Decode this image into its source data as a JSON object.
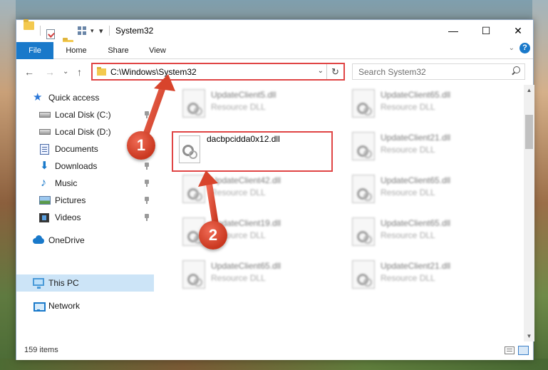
{
  "window": {
    "title": "System32",
    "minimize_glyph": "—",
    "maximize_glyph": "☐",
    "close_glyph": "✕"
  },
  "ribbon": {
    "tabs": [
      "File",
      "Home",
      "Share",
      "View"
    ],
    "help_glyph": "?",
    "expand_glyph": "⌄"
  },
  "address_bar": {
    "path": "C:\\Windows\\System32",
    "back_glyph": "←",
    "forward_glyph": "→",
    "recent_glyph": "⌄",
    "up_glyph": "↑",
    "dropdown_glyph": "⌄",
    "refresh_glyph": "↻"
  },
  "search": {
    "placeholder": "Search System32"
  },
  "nav_pane": {
    "items": [
      {
        "label": "Quick access",
        "icon": "star-icon",
        "pinned": false
      },
      {
        "label": "Local Disk (C:)",
        "icon": "drive-icon",
        "pinned": true
      },
      {
        "label": "Local Disk (D:)",
        "icon": "drive-icon",
        "pinned": false
      },
      {
        "label": "Documents",
        "icon": "documents-icon",
        "pinned": true
      },
      {
        "label": "Downloads",
        "icon": "download-icon",
        "pinned": true
      },
      {
        "label": "Music",
        "icon": "music-icon",
        "pinned": true
      },
      {
        "label": "Pictures",
        "icon": "pictures-icon",
        "pinned": true
      },
      {
        "label": "Videos",
        "icon": "videos-icon",
        "pinned": true
      },
      {
        "label": "OneDrive",
        "icon": "cloud-icon",
        "pinned": false
      },
      {
        "label": "This PC",
        "icon": "computer-icon",
        "pinned": false,
        "selected": true
      },
      {
        "label": "Network",
        "icon": "network-icon",
        "pinned": false
      }
    ]
  },
  "files": {
    "left_column": [
      {
        "name": "UpdateClient5.dll",
        "type": "Resource DLL"
      },
      {
        "name": "dacbpcidda0x12.dll",
        "type": ""
      },
      {
        "name": "UpdateClient42.dll",
        "type": "Resource DLL"
      },
      {
        "name": "UpdateClient19.dll",
        "type": "Resource DLL"
      },
      {
        "name": "UpdateClient65.dll",
        "type": "Resource DLL"
      }
    ],
    "right_column": [
      {
        "name": "UpdateClient65.dll",
        "type": "Resource DLL"
      },
      {
        "name": "UpdateClient21.dll",
        "type": "Resource DLL"
      },
      {
        "name": "UpdateClient65.dll",
        "type": "Resource DLL"
      },
      {
        "name": "UpdateClient65.dll",
        "type": "Resource DLL"
      },
      {
        "name": "UpdateClient21.dll",
        "type": "Resource DLL"
      }
    ]
  },
  "status_bar": {
    "item_count": "159 items"
  },
  "annotations": {
    "callout_1": "1",
    "callout_2": "2"
  },
  "colors": {
    "accent": "#1979ca",
    "highlight": "#e04545",
    "selection": "#cce4f7"
  }
}
